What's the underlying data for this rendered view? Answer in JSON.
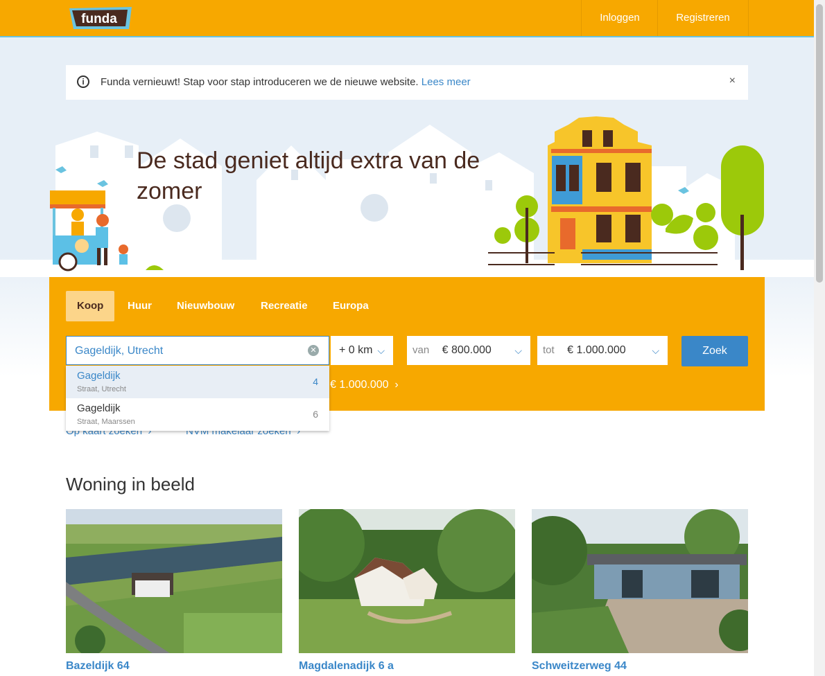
{
  "header": {
    "logo_text": "funda",
    "login_label": "Inloggen",
    "register_label": "Registreren"
  },
  "notice": {
    "text": "Funda vernieuwt! Stap voor stap introduceren we de nieuwe website.",
    "link": "Lees meer",
    "close": "×",
    "info": "i"
  },
  "hero": {
    "headline": "De stad geniet altijd extra van de zomer"
  },
  "search": {
    "tabs": [
      {
        "label": "Koop",
        "active": true
      },
      {
        "label": "Huur"
      },
      {
        "label": "Nieuwbouw"
      },
      {
        "label": "Recreatie"
      },
      {
        "label": "Europa"
      }
    ],
    "query": "Gageldijk, Utrecht",
    "radius": "+ 0 km",
    "price_from_label": "van",
    "price_from_value": "€ 800.000",
    "price_to_label": "tot",
    "price_to_value": "€ 1.000.000",
    "submit_label": "Zoek",
    "last_search": "€ 1.000.000",
    "suggestions": [
      {
        "title": "Gageldijk",
        "subtitle": "Straat, Utrecht",
        "count": "4"
      },
      {
        "title": "Gageldijk",
        "subtitle": "Straat, Maarssen",
        "count": "6"
      }
    ],
    "links": [
      "Op kaart zoeken",
      "NVM makelaar zoeken"
    ]
  },
  "featured": {
    "title": "Woning in beeld",
    "listings": [
      {
        "address": "Bazeldijk 64"
      },
      {
        "address": "Magdalenadijk 6 a"
      },
      {
        "address": "Schweitzerweg 44"
      }
    ]
  },
  "colors": {
    "brand_orange": "#f7a800",
    "link_blue": "#3a87c8",
    "heading_brown": "#4a2a1f"
  }
}
